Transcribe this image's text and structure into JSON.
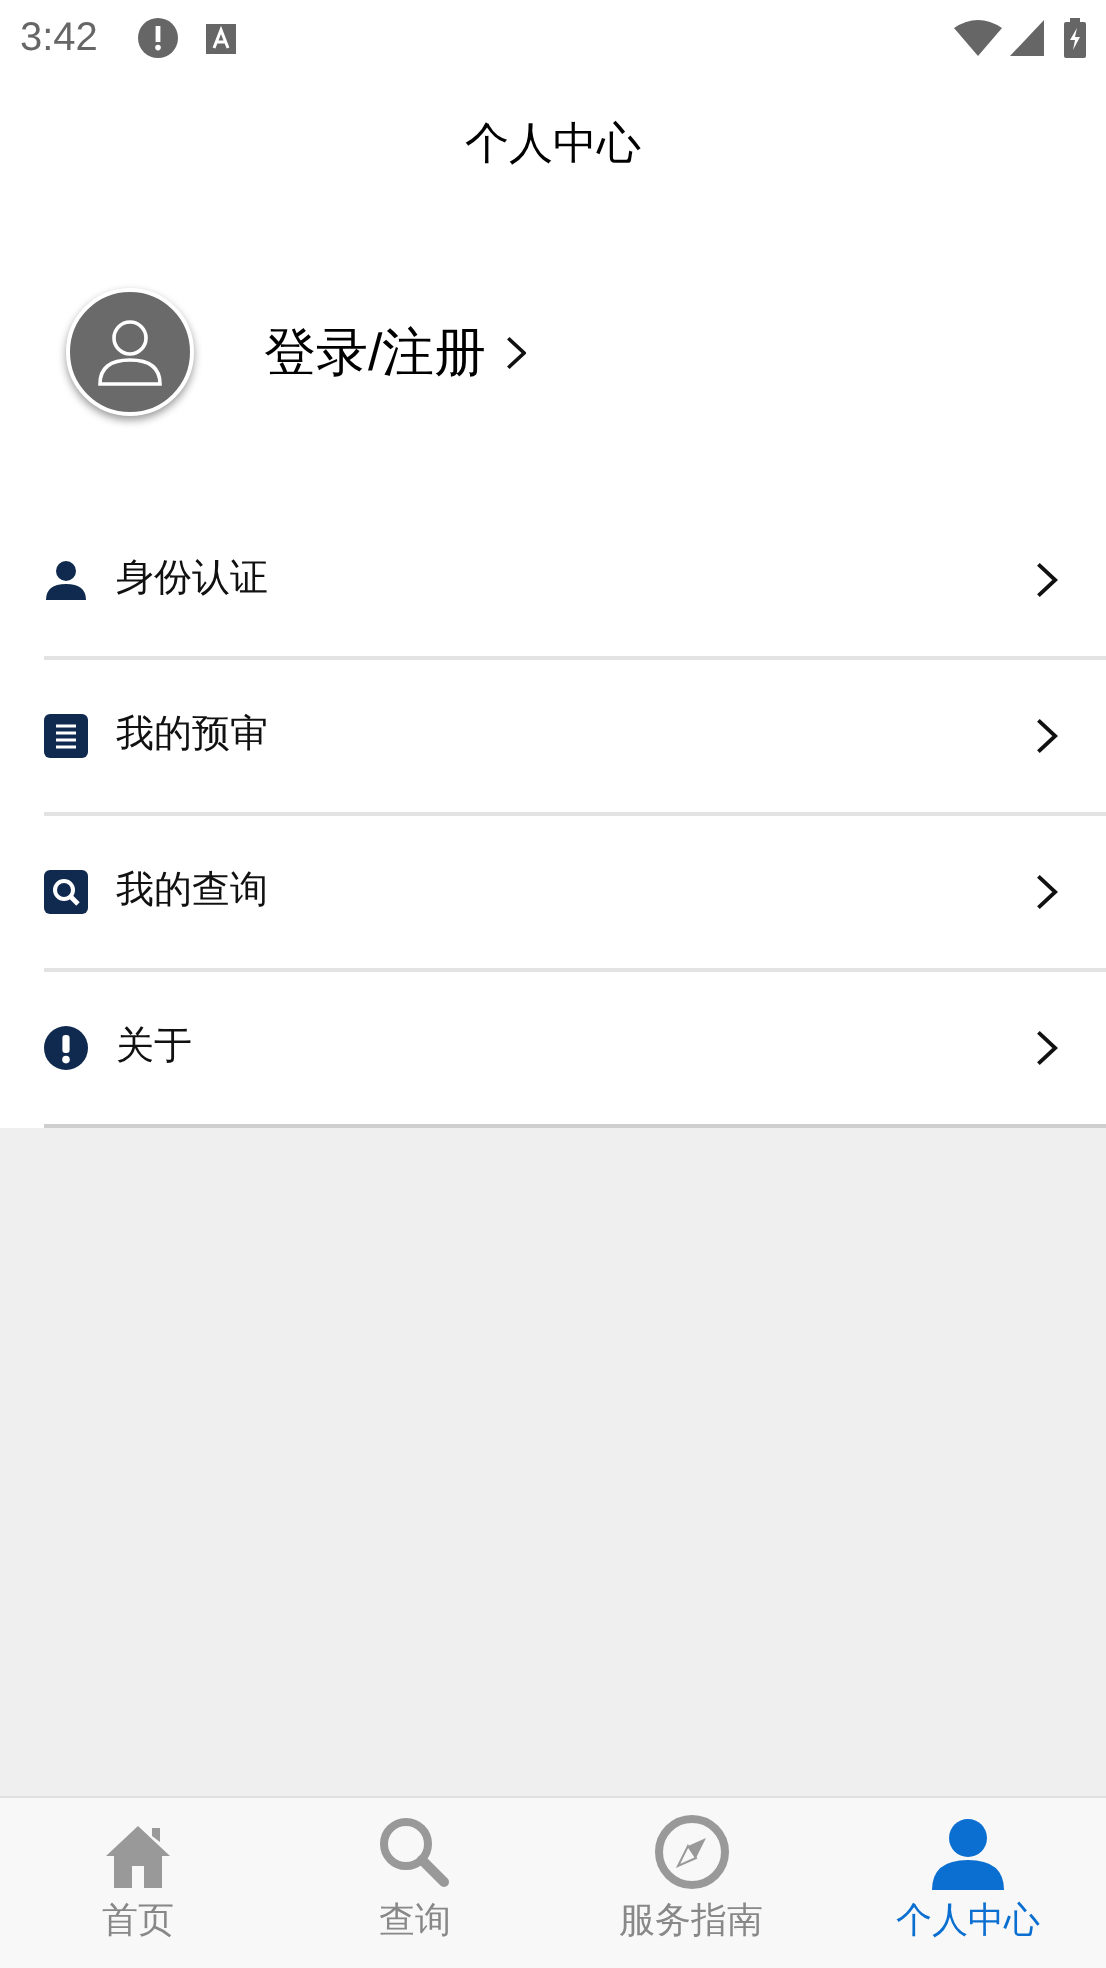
{
  "status_bar": {
    "time": "3:42"
  },
  "header": {
    "title": "个人中心"
  },
  "profile": {
    "login_label": "登录/注册"
  },
  "menu": [
    {
      "kind": "person",
      "label": "身份认证"
    },
    {
      "kind": "list",
      "label": "我的预审"
    },
    {
      "kind": "search",
      "label": "我的查询"
    },
    {
      "kind": "alert",
      "label": "关于"
    }
  ],
  "tab_bar": [
    {
      "kind": "home",
      "label": "首页",
      "selected": false
    },
    {
      "kind": "search",
      "label": "查询",
      "selected": false
    },
    {
      "kind": "compass",
      "label": "服务指南",
      "selected": false
    },
    {
      "kind": "person",
      "label": "个人中心",
      "selected": true
    }
  ]
}
